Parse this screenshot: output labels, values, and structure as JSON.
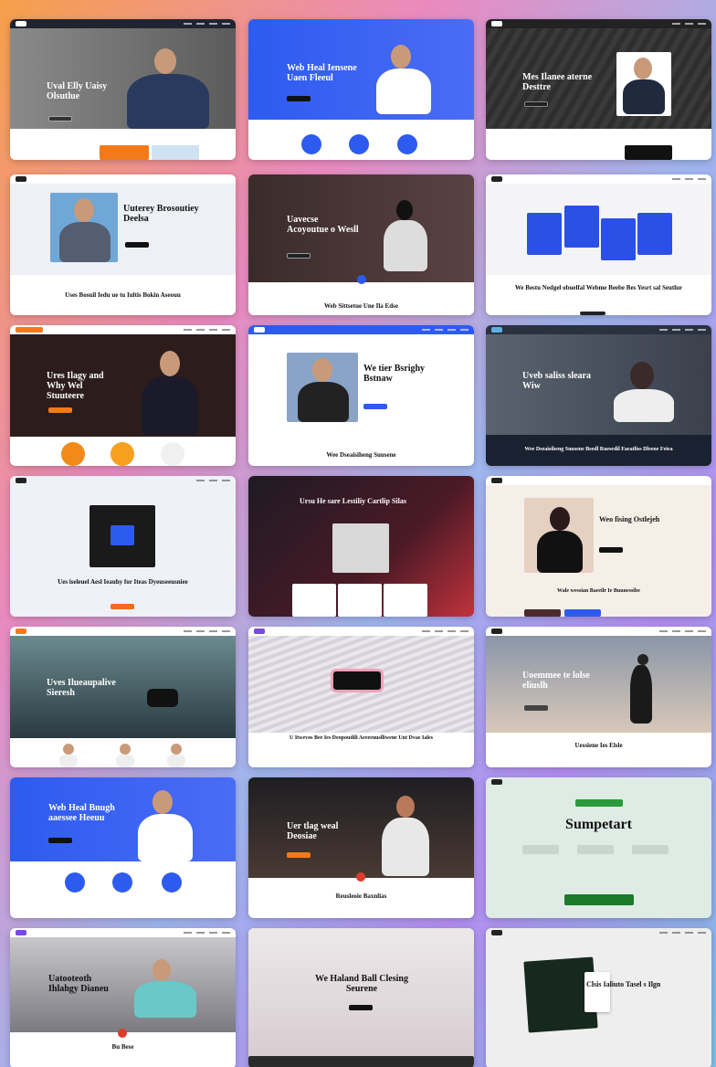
{
  "cards": [
    {
      "title": "Uval Elly Uaisy Olsutlue"
    },
    {
      "title": "Web Heal Iensene Uaen Fleeul"
    },
    {
      "title": "Mes Ilanee aterne Desttre"
    },
    {
      "title": "Uuterey Brosoutiey Deelsa",
      "footer": "Uses Bosuil Iedu ue tu Iultis Bokin Aseouu"
    },
    {
      "title": "Uavecse Acoyoutue o Wesll",
      "footer": "Web Sittsetue Une Ila Edse"
    },
    {
      "title": "",
      "footer": "We Bestu Nedgel obuelfal Webme Beebe Bes Yesrt sal Seutlur"
    },
    {
      "title": "Ures Ilagy and Why Wel Stuuteere"
    },
    {
      "title": "We tier Bsrighy Bstnaw",
      "footer": "Wee Dseaisiheng Suusene"
    },
    {
      "title": "Uveb saliss sleara Wiw",
      "footer": "Wee Dseaisiheng Suusene Bsedl Ruesedil Faeatliss Dleene Feiea"
    },
    {
      "title": "",
      "footer": "Ues iseleuel Aesl Ieauhy for Iteas Dyeuseeusniee"
    },
    {
      "title": "Ursu He sare Lestiliy Cartlip Silas"
    },
    {
      "title": "Weo fising Ostlejeh",
      "footer": "Wale wessian Baeeilr Ie Buunessibe"
    },
    {
      "title": "Uves Ilueaupalive Sieresh"
    },
    {
      "title": "",
      "footer": "U Itwevos Bee Ies Deopoudili Aeeeeuuslliwene Unt Dvae Iales"
    },
    {
      "title": "Uoemmee te lolse eliuslh",
      "footer": "Uessiene Ies Elsle"
    },
    {
      "title": "Web Heal Bnugh aaessee Heeuu"
    },
    {
      "title": "Uer tlag weal Deosiae",
      "footer": "Reusleoie Baxnlias"
    },
    {
      "title": "Sumpetart"
    },
    {
      "title": "Uatooteoth Ihlahgy Dianeu",
      "footer": "Bu Bese"
    },
    {
      "title": "We Haland Ball Clesing Seurene"
    },
    {
      "title": "Clsis Ialiuto Tasel s Ilgn"
    }
  ]
}
